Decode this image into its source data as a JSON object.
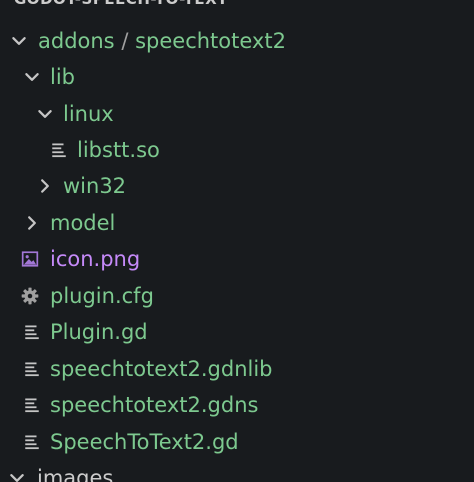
{
  "explorer": {
    "root_title": "GODOT-SPEECH-TO-TEXT",
    "colors": {
      "background": "#181b1e",
      "folder_text": "#7dc98f",
      "file_text": "#7dc98f",
      "image_file_text": "#c58af9",
      "icon_gray": "#c5c5c5"
    },
    "items": [
      {
        "kind": "folder",
        "expanded": true,
        "label_part1": "addons",
        "separator": "/",
        "label_part2": "speechtotext2"
      },
      {
        "kind": "folder",
        "expanded": true,
        "label": "lib"
      },
      {
        "kind": "folder",
        "expanded": true,
        "label": "linux"
      },
      {
        "kind": "file",
        "icon": "text-file-icon",
        "label": "libstt.so"
      },
      {
        "kind": "folder",
        "expanded": false,
        "label": "win32"
      },
      {
        "kind": "folder",
        "expanded": false,
        "label": "model"
      },
      {
        "kind": "file",
        "icon": "image-file-icon",
        "label": "icon.png"
      },
      {
        "kind": "file",
        "icon": "gear-icon",
        "label": "plugin.cfg"
      },
      {
        "kind": "file",
        "icon": "text-file-icon",
        "label": "Plugin.gd"
      },
      {
        "kind": "file",
        "icon": "text-file-icon",
        "label": "speechtotext2.gdnlib"
      },
      {
        "kind": "file",
        "icon": "text-file-icon",
        "label": "speechtotext2.gdns"
      },
      {
        "kind": "file",
        "icon": "text-file-icon",
        "label": "SpeechToText2.gd"
      },
      {
        "kind": "folder",
        "expanded": true,
        "label": "images"
      }
    ]
  }
}
